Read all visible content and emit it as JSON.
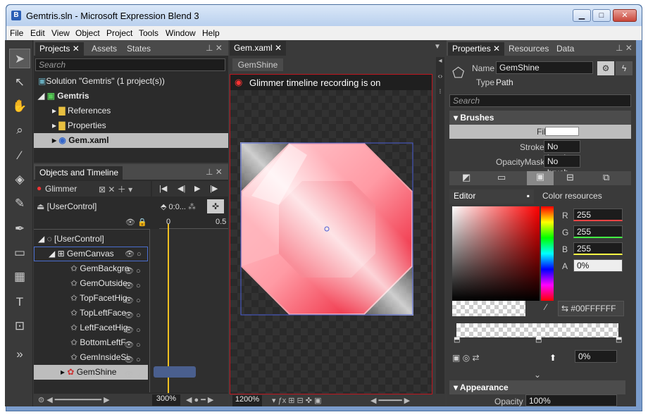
{
  "window": {
    "title": "Gemtris.sln - Microsoft Expression Blend 3",
    "app_icon": "B",
    "min": "▁",
    "max": "□",
    "close": "✕"
  },
  "menu": [
    "File",
    "Edit",
    "View",
    "Object",
    "Project",
    "Tools",
    "Window",
    "Help"
  ],
  "projects": {
    "tabs": [
      "Projects",
      "Assets",
      "States"
    ],
    "search_placeholder": "Search",
    "solution": "Solution \"Gemtris\" (1 project(s))",
    "project": "Gemtris",
    "items": [
      "References",
      "Properties",
      "Gem.xaml"
    ]
  },
  "objects": {
    "title": "Objects and Timeline",
    "storyboard": "Glimmer",
    "scope": "[UserControl]",
    "time": "0:0...",
    "t0": "0",
    "t1": "0.5",
    "root": "[UserControl]",
    "canvas": "GemCanvas",
    "children": [
      "GemBackgro",
      "GemOutside",
      "TopFacetHig",
      "TopLeftFace",
      "LeftFacetHig",
      "BottomLeftF",
      "GemInsideSi",
      "GemShine"
    ],
    "zoom": "300%"
  },
  "doc": {
    "tab": "Gem.xaml",
    "breadcrumb": "GemShine",
    "recording": "Glimmer timeline recording is on",
    "zoom": "1200%"
  },
  "props": {
    "tabs": [
      "Properties",
      "Resources",
      "Data"
    ],
    "name_label": "Name",
    "name_value": "GemShine",
    "type_label": "Type",
    "type_value": "Path",
    "search_placeholder": "Search",
    "brushes": "Brushes",
    "fill": "Fill",
    "stroke": "Stroke",
    "stroke_value": "No brush",
    "opacity_mask": "OpacityMask",
    "opacity_mask_value": "No brush",
    "editor_tab": "Editor",
    "color_resources_tab": "Color resources",
    "r_label": "R",
    "r_value": "255",
    "g_label": "G",
    "g_value": "255",
    "b_label": "B",
    "b_value": "255",
    "a_label": "A",
    "a_value": "0%",
    "hex": "#00FFFFFF",
    "stop_opacity": "0%",
    "appearance": "Appearance",
    "opacity_label": "Opacity",
    "opacity_value": "100%"
  },
  "colors": {
    "gem_red": "#e8001a",
    "recording_border": "#c0151f",
    "selection_blue": "#4a5fd6"
  }
}
